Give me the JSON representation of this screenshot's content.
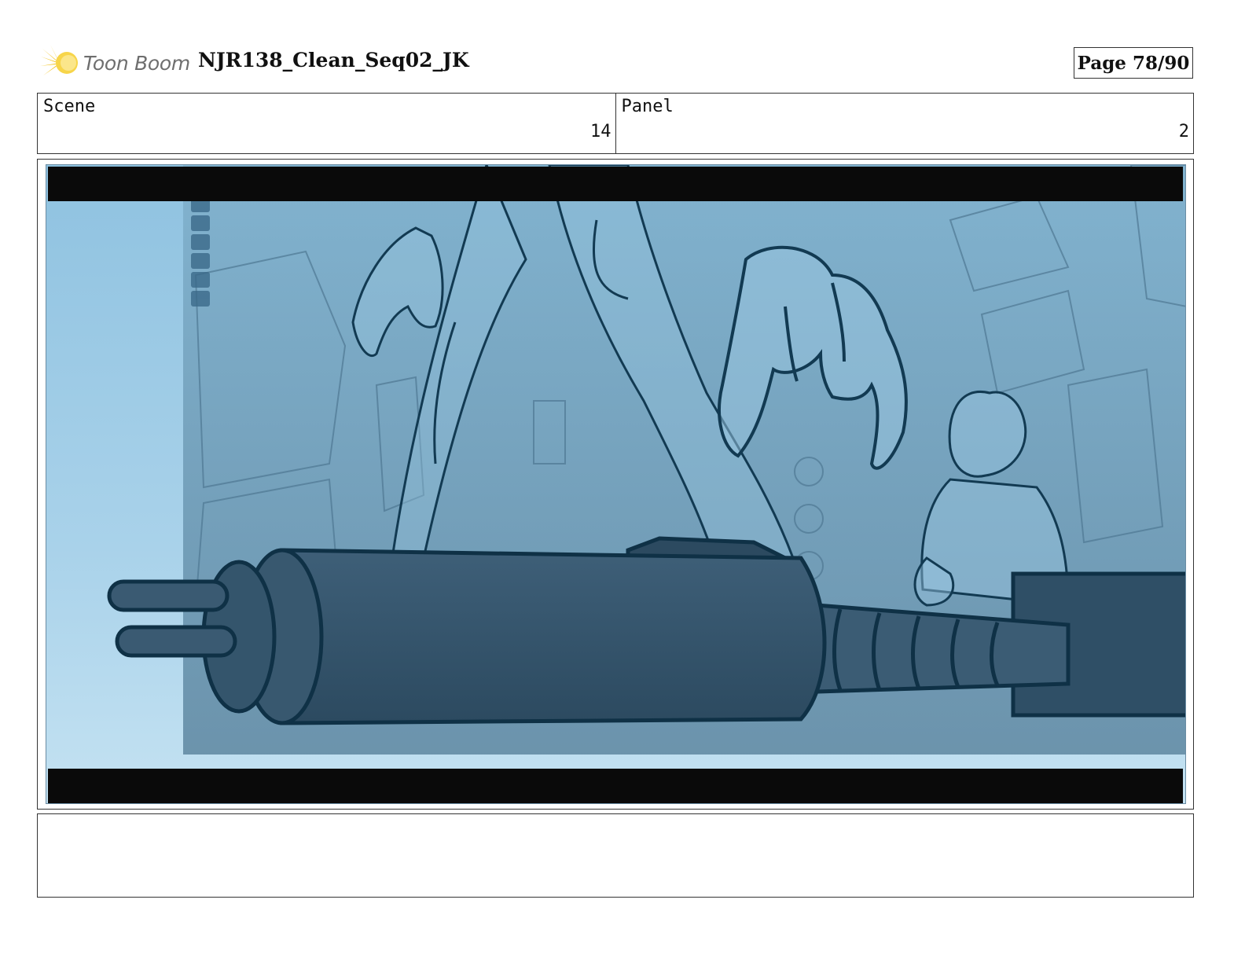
{
  "header": {
    "logo_text": "Toon Boom",
    "project_title": "NJR138_Clean_Seq02_JK",
    "page_label": "Page 78/90"
  },
  "info": {
    "scene_label": "Scene",
    "scene_value": "14",
    "panel_label": "Panel",
    "panel_value": "2"
  },
  "panel": {
    "description": "",
    "colors": {
      "sky": "#a9d2ea",
      "background": "#7ea9c4",
      "line": "#123a52",
      "letterbox": "#0a0a0a"
    }
  },
  "notes": {
    "text": ""
  }
}
